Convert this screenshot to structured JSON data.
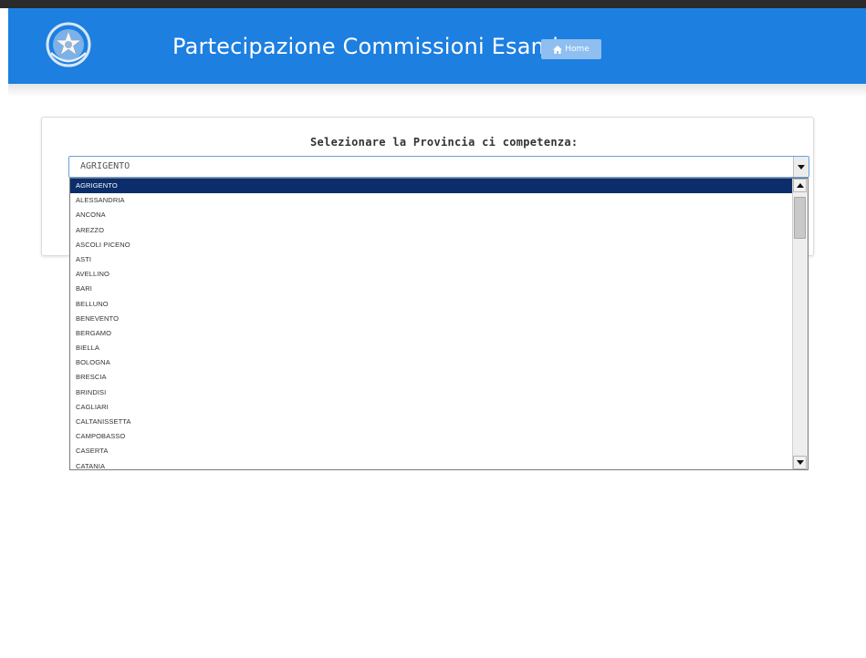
{
  "header": {
    "title": "Partecipazione Commissioni Esami",
    "home_label": "Home",
    "brand_color": "#1d7fe0"
  },
  "main": {
    "prompt": "Selezionare la Provincia ci competenza:",
    "select": {
      "value": "AGRIGENTO",
      "options": [
        "AGRIGENTO",
        "ALESSANDRIA",
        "ANCONA",
        "AREZZO",
        "ASCOLI PICENO",
        "ASTI",
        "AVELLINO",
        "BARI",
        "BELLUNO",
        "BENEVENTO",
        "BERGAMO",
        "BIELLA",
        "BOLOGNA",
        "BRESCIA",
        "BRINDISI",
        "CAGLIARI",
        "CALTANISSETTA",
        "CAMPOBASSO",
        "CASERTA",
        "CATANIA"
      ],
      "highlighted_index": 0,
      "highlight_color": "#0b2d6b"
    }
  },
  "icons": {
    "emblem": "italian-republic-emblem-icon",
    "home": "home-icon",
    "select_arrow": "chevron-down-icon",
    "scroll_up": "scroll-up-arrow-icon",
    "scroll_down": "scroll-down-arrow-icon"
  }
}
